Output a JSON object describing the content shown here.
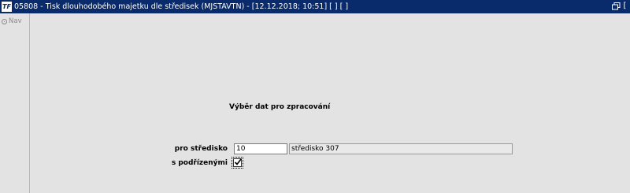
{
  "window": {
    "title": "05808 - Tisk dlouhodobého majetku dle středisek (MJSTAVTN) - [12.12.2018; 10:51]  [ ]  [ ]",
    "app_icon_glyph": "TF"
  },
  "sidebar": {
    "nav_label": "Nav"
  },
  "form": {
    "section_title": "Výběr dat pro zpracování",
    "stredisko": {
      "label": "pro středisko",
      "code_value": "10",
      "name_value": "středisko 307"
    },
    "podrizenymi": {
      "label": "s podřízenými",
      "checked": true
    }
  },
  "colors": {
    "titlebar": "#0a2b6b",
    "background": "#e3e3e3"
  }
}
